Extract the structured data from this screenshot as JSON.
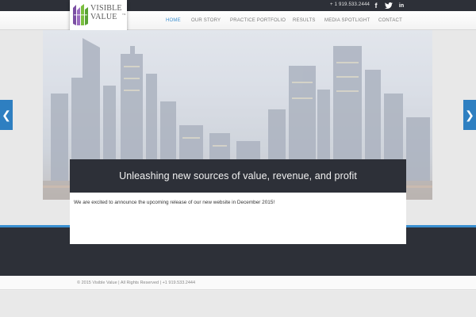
{
  "header": {
    "phone": "+ 1 919.533.2444",
    "social": [
      {
        "name": "facebook",
        "glyph": "f",
        "icon": "facebook-icon"
      },
      {
        "name": "twitter",
        "glyph": "🐦",
        "icon": "twitter-icon"
      },
      {
        "name": "linkedin",
        "glyph": "in",
        "icon": "linkedin-icon"
      }
    ]
  },
  "logo": {
    "line1": "VISIBLE",
    "line2": "VALUE",
    "trademark": "TM"
  },
  "nav": {
    "items": [
      {
        "label": "HOME",
        "active": true
      },
      {
        "label": "OUR STORY",
        "active": false
      },
      {
        "label": "PRACTICE PORTFOLIO",
        "active": false
      },
      {
        "label": "RESULTS",
        "active": false
      },
      {
        "label": "MEDIA SPOTLIGHT",
        "active": false
      },
      {
        "label": "CONTACT",
        "active": false
      }
    ]
  },
  "hero": {
    "prev_glyph": "❮",
    "next_glyph": "❯"
  },
  "panel": {
    "title": "Unleashing new sources of value, revenue, and profit",
    "body": "We are excited to announce the upcoming release of our new website in December 2015!"
  },
  "footer": {
    "text": "© 2015 Visible Value | All Rights Reserved | +1 919.533.2444"
  },
  "colors": {
    "accent": "#3c8fcf",
    "dark": "#2d3038",
    "arrow": "#2e7fc1"
  }
}
